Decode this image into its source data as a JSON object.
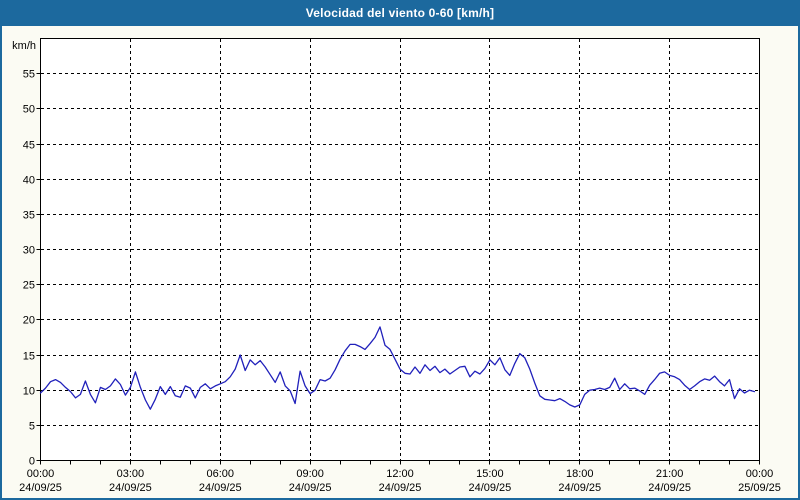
{
  "header": {
    "title": "Velocidad del viento 0-60 [km/h]"
  },
  "colors": {
    "titlebar_bg": "#1c699e",
    "titlebar_text": "#ffffff",
    "window_bg": "#fbfbf3",
    "frame_border": "#1c699e",
    "plot_bg": "#ffffff",
    "axis": "#000000",
    "grid": "#000000",
    "tick_text": "#000000",
    "line": "#2121bb"
  },
  "chart_data": {
    "type": "line",
    "title": "Velocidad del viento 0-60 [km/h]",
    "unit_label": "km/h",
    "ylim": [
      0,
      60
    ],
    "yticks": [
      0,
      5,
      10,
      15,
      20,
      25,
      30,
      35,
      40,
      45,
      50,
      55
    ],
    "x_minutes_range": [
      0,
      1440
    ],
    "minor_tick_every_hours": 1,
    "grid": "dashed",
    "legend": "none",
    "x_major_ticks": [
      {
        "hour": 0,
        "time": "00:00",
        "date": "24/09/25"
      },
      {
        "hour": 3,
        "time": "03:00",
        "date": "24/09/25"
      },
      {
        "hour": 6,
        "time": "06:00",
        "date": "24/09/25"
      },
      {
        "hour": 9,
        "time": "09:00",
        "date": "24/09/25"
      },
      {
        "hour": 12,
        "time": "12:00",
        "date": "24/09/25"
      },
      {
        "hour": 15,
        "time": "15:00",
        "date": "24/09/25"
      },
      {
        "hour": 18,
        "time": "18:00",
        "date": "24/09/25"
      },
      {
        "hour": 21,
        "time": "21:00",
        "date": "24/09/25"
      },
      {
        "hour": 24,
        "time": "00:00",
        "date": "25/09/25"
      }
    ],
    "series": [
      {
        "name": "Velocidad del viento",
        "color": "#2121bb",
        "sample_interval_minutes": 10,
        "values": [
          9.6,
          10.3,
          11.2,
          11.5,
          11.1,
          10.4,
          9.8,
          8.9,
          9.4,
          11.3,
          9.4,
          8.2,
          10.4,
          10.1,
          10.6,
          11.6,
          10.8,
          9.3,
          10.4,
          12.6,
          10.4,
          8.6,
          7.3,
          8.7,
          10.5,
          9.4,
          10.5,
          9.2,
          9.0,
          10.6,
          10.3,
          8.9,
          10.4,
          10.9,
          10.2,
          10.6,
          10.9,
          11.2,
          11.9,
          13.0,
          15.0,
          12.8,
          14.3,
          13.6,
          14.2,
          13.3,
          12.2,
          11.1,
          12.6,
          10.6,
          9.9,
          8.1,
          12.7,
          10.6,
          9.5,
          10.0,
          11.5,
          11.3,
          11.7,
          12.9,
          14.4,
          15.6,
          16.5,
          16.5,
          16.2,
          15.8,
          16.6,
          17.5,
          19.0,
          16.4,
          15.8,
          14.4,
          13.0,
          12.4,
          12.3,
          13.3,
          12.4,
          13.6,
          12.8,
          13.4,
          12.5,
          13.0,
          12.3,
          12.8,
          13.3,
          13.4,
          11.9,
          12.7,
          12.3,
          13.1,
          14.3,
          13.6,
          14.6,
          12.9,
          12.1,
          13.8,
          15.2,
          14.6,
          13.0,
          11.0,
          9.2,
          8.7,
          8.6,
          8.5,
          8.8,
          8.4,
          7.9,
          7.6,
          7.9,
          9.4,
          10.0,
          10.1,
          10.3,
          10.1,
          10.4,
          11.7,
          10.1,
          10.9,
          10.2,
          10.3,
          9.9,
          9.4,
          10.7,
          11.5,
          12.4,
          12.6,
          12.1,
          11.9,
          11.5,
          10.7,
          10.1,
          10.6,
          11.2,
          11.6,
          11.4,
          12.0,
          11.2,
          10.6,
          11.5,
          8.8,
          10.2,
          9.6,
          10.0,
          9.8
        ]
      }
    ]
  }
}
